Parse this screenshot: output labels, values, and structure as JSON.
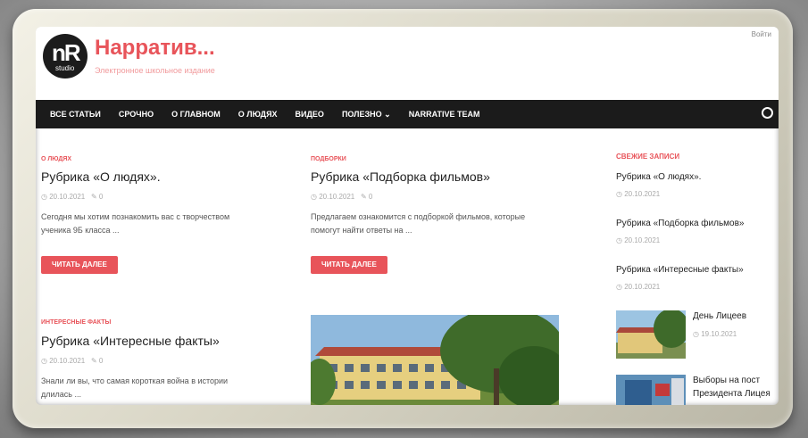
{
  "site": {
    "title": "Нарратив...",
    "tagline": "Электронное школьное издание",
    "logo_mark": "nR",
    "logo_sub": "studio",
    "top_right": "Войти"
  },
  "nav": {
    "items": [
      "ВСЕ СТАТЬИ",
      "СРОЧНО",
      "О ГЛАВНОМ",
      "О ЛЮДЯХ",
      "ВИДЕО",
      "ПОЛЕЗНО ⌄",
      "NARRATIVE TEAM"
    ]
  },
  "posts": [
    {
      "category": "О ЛЮДЯХ",
      "title": "Рубрика «О людях».",
      "date": "20.10.2021",
      "comments": "0",
      "excerpt_1": "Сегодня мы хотим познакомить вас с творчеством",
      "excerpt_2": "ученика 9Б класса ...",
      "button": "ЧИТАТЬ ДАЛЕЕ"
    },
    {
      "category": "ПОДБОРКИ",
      "title": "Рубрика «Подборка фильмов»",
      "date": "20.10.2021",
      "comments": "0",
      "excerpt_1": "Предлагаем ознакомится с подборкой фильмов, которые",
      "excerpt_2": "помогут найти ответы на ...",
      "button": "ЧИТАТЬ ДАЛЕЕ"
    },
    {
      "category": "ИНТЕРЕСНЫЕ ФАКТЫ",
      "title": "Рубрика «Интересные факты»",
      "date": "20.10.2021",
      "comments": "0",
      "excerpt_1": "Знали ли вы, что самая короткая война в истории",
      "excerpt_2": "длилась ..."
    }
  ],
  "sidebar": {
    "heading": "СВЕЖИЕ ЗАПИСИ",
    "items": [
      {
        "title": "Рубрика «О людях».",
        "date": "20.10.2021"
      },
      {
        "title": "Рубрика «Подборка фильмов»",
        "date": "20.10.2021"
      },
      {
        "title": "Рубрика «Интересные факты»",
        "date": "20.10.2021"
      },
      {
        "title": "День Лицеев",
        "date": "19.10.2021"
      },
      {
        "title_1": "Выборы на пост",
        "title_2": "Президента Лицея"
      }
    ]
  },
  "icons": {
    "clock": "clock-icon",
    "comment": "comment-icon",
    "search": "search-icon"
  },
  "colors": {
    "accent": "#e8545a",
    "nav_bg": "#1b1b1b"
  }
}
